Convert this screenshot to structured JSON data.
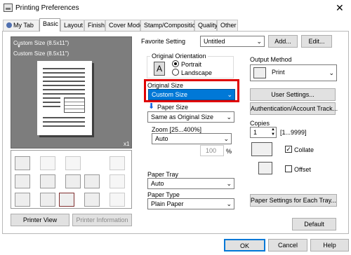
{
  "window": {
    "title": "Printing Preferences",
    "close_glyph": "✕"
  },
  "tabs": [
    {
      "label": "My Tab"
    },
    {
      "label": "Basic"
    },
    {
      "label": "Layout"
    },
    {
      "label": "Finish"
    },
    {
      "label": "Cover Mode"
    },
    {
      "label": "Stamp/Composition"
    },
    {
      "label": "Quality"
    },
    {
      "label": "Other"
    }
  ],
  "preview": {
    "line1": "Custom Size (8.5x11\")",
    "arrow": "▼",
    "line2": "Custom Size (8.5x11\")",
    "copies": "x1"
  },
  "favorite": {
    "label": "Favorite Setting",
    "value": "Untitled",
    "add_label": "Add...",
    "edit_label": "Edit..."
  },
  "orientation": {
    "group_label": "Original Orientation",
    "portrait_label": "Portrait",
    "landscape_label": "Landscape",
    "selected": "Portrait"
  },
  "original_size": {
    "label": "Original Size",
    "value": "Custom Size"
  },
  "paper_size": {
    "label": "Paper Size",
    "value": "Same as Original Size"
  },
  "zoom": {
    "label": "Zoom [25...400%]",
    "value": "Auto",
    "spin_value": "100",
    "unit": "%"
  },
  "paper_tray": {
    "label": "Paper Tray",
    "value": "Auto"
  },
  "paper_type": {
    "label": "Paper Type",
    "value": "Plain Paper"
  },
  "output": {
    "label": "Output Method",
    "value": "Print",
    "user_settings_label": "User Settings...",
    "auth_label": "Authentication/Account Track..."
  },
  "copies": {
    "label": "Copies",
    "value": "1",
    "range": "[1...9999]"
  },
  "collate": {
    "label": "Collate",
    "checked": true
  },
  "offset": {
    "label": "Offset",
    "checked": false
  },
  "paper_settings_label": "Paper Settings for Each Tray...",
  "left_buttons": {
    "printer_view": "Printer View",
    "printer_info": "Printer Information"
  },
  "default_label": "Default",
  "footer": {
    "ok": "OK",
    "cancel": "Cancel",
    "help": "Help"
  }
}
